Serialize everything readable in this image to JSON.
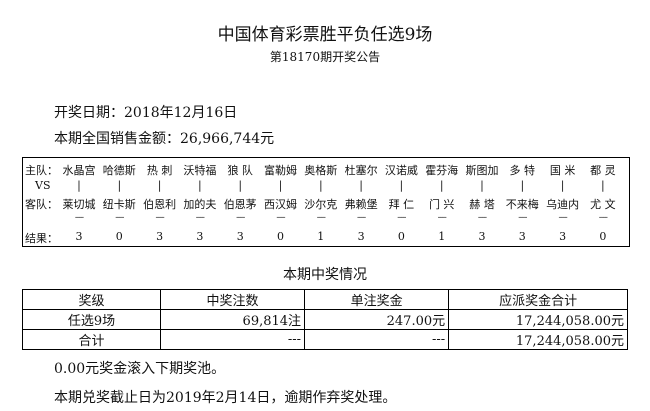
{
  "header": {
    "title": "中国体育彩票胜平负任选9场",
    "subtitle": "第18170期开奖公告"
  },
  "info": {
    "draw_date": "开奖日期：2018年12月16日",
    "sales": "本期全国销售金额：26,966,744元"
  },
  "matches": {
    "labels": {
      "home": "主队：",
      "vs": "VS",
      "away": "客队：",
      "result": "结果："
    },
    "bar": "|",
    "dash": "----",
    "items": [
      {
        "home": "水晶宫",
        "away": "莱切城",
        "result": "3"
      },
      {
        "home": "哈德斯",
        "away": "纽卡斯",
        "result": "0"
      },
      {
        "home": "热 刺",
        "away": "伯恩利",
        "result": "3"
      },
      {
        "home": "沃特福",
        "away": "加的夫",
        "result": "3"
      },
      {
        "home": "狼 队",
        "away": "伯恩茅",
        "result": "3"
      },
      {
        "home": "富勒姆",
        "away": "西汉姆",
        "result": "0"
      },
      {
        "home": "奥格斯",
        "away": "沙尔克",
        "result": "1"
      },
      {
        "home": "杜塞尔",
        "away": "弗赖堡",
        "result": "3"
      },
      {
        "home": "汉诺威",
        "away": "拜 仁",
        "result": "0"
      },
      {
        "home": "霍芬海",
        "away": "门 兴",
        "result": "1"
      },
      {
        "home": "斯图加",
        "away": "赫 塔",
        "result": "3"
      },
      {
        "home": "多 特",
        "away": "不来梅",
        "result": "3"
      },
      {
        "home": "国 米",
        "away": "乌迪内",
        "result": "3"
      },
      {
        "home": "都 灵",
        "away": "尤 文",
        "result": "0"
      }
    ]
  },
  "prize": {
    "section_title": "本期中奖情况",
    "headers": [
      "奖级",
      "中奖注数",
      "单注奖金",
      "应派奖金合计"
    ],
    "rows": [
      [
        "任选9场",
        "69,814注",
        "247.00元",
        "17,244,058.00元"
      ],
      [
        "合计",
        "---",
        "---",
        "17,244,058.00元"
      ]
    ]
  },
  "footer": {
    "rollover": "0.00元奖金滚入下期奖池。",
    "deadline": "本期兑奖截止日为2019年2月14日，逾期作弃奖处理。"
  }
}
